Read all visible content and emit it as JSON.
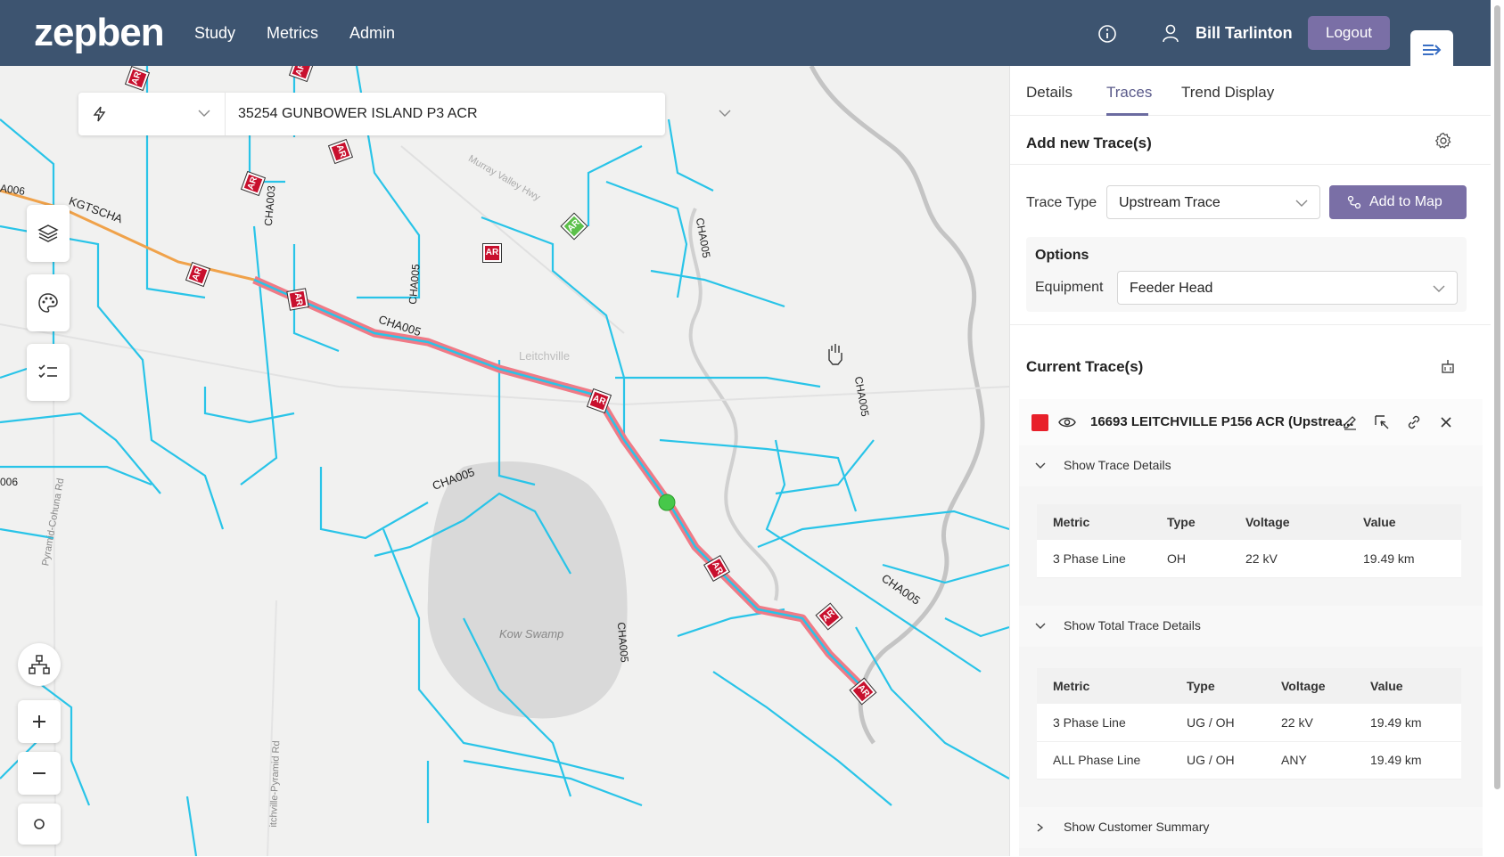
{
  "header": {
    "logo": "zepben",
    "nav": [
      "Study",
      "Metrics",
      "Admin"
    ],
    "user_name": "Bill Tarlinton",
    "logout_label": "Logout"
  },
  "map": {
    "feeder_select_value": "35254 GUNBOWER ISLAND P3 ACR",
    "labels": {
      "kgtscha": "KGTSCHA",
      "a006": "A006",
      "a006b": "006",
      "cha003": "CHA003",
      "cha005_a": "CHA005",
      "cha005_b": "CHA005",
      "cha005_c": "CHA005",
      "cha005_d": "CHA005",
      "cha005_e": "CHA005",
      "cha005_f": "CHA005",
      "cha005_g": "CHA005",
      "leitchville": "Leitchville",
      "kow_swamp": "Kow Swamp",
      "murray_valley": "Murray Valley Hwy",
      "pyramid_cohuna": "Pyramid-Cohuna Rd",
      "leitchville_pyramid": "itchville-Pyramid Rd",
      "ar": "AR"
    }
  },
  "panel": {
    "tabs": [
      "Details",
      "Traces",
      "Trend Display"
    ],
    "active_tab": "Traces",
    "add_new_title": "Add new Trace(s)",
    "trace_type_label": "Trace Type",
    "trace_type_value": "Upstream Trace",
    "add_to_map_label": "Add to Map",
    "options_title": "Options",
    "equipment_label": "Equipment",
    "equipment_value": "Feeder Head",
    "current_title": "Current Trace(s)",
    "trace": {
      "name": "16693 LEITCHVILLE P156 ACR (Upstrea...",
      "color": "#e8202a"
    },
    "show_trace_details": "Show Trace Details",
    "trace_details": {
      "headers": [
        "Metric",
        "Type",
        "Voltage",
        "Value"
      ],
      "rows": [
        [
          "3 Phase Line",
          "OH",
          "22 kV",
          "19.49 km"
        ]
      ]
    },
    "show_total_trace_details": "Show Total Trace Details",
    "total_trace_details": {
      "headers": [
        "Metric",
        "Type",
        "Voltage",
        "Value"
      ],
      "rows": [
        [
          "3 Phase Line",
          "UG / OH",
          "22 kV",
          "19.49 km"
        ],
        [
          "ALL Phase Line",
          "UG / OH",
          "ANY",
          "19.49 km"
        ]
      ]
    },
    "show_customer_summary": "Show Customer Summary"
  },
  "colors": {
    "header_bg": "#3d5470",
    "accent": "#7a6fa6",
    "network_line": "#29c4e8",
    "trace_highlight": "#f07a86"
  }
}
